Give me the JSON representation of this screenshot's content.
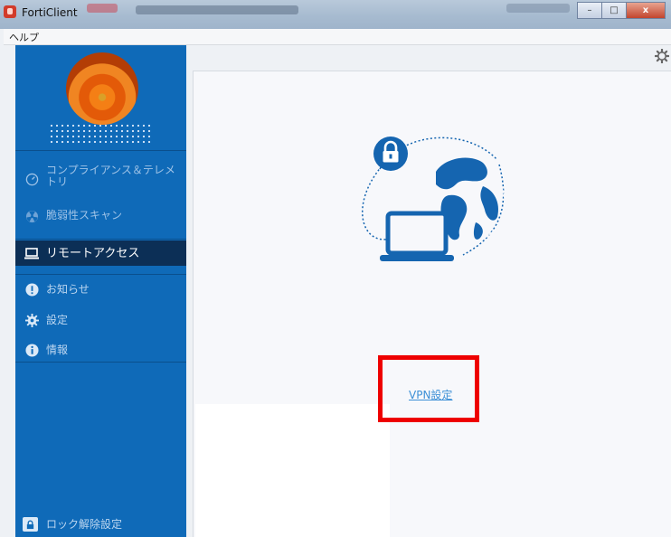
{
  "window": {
    "title": "FortiClient",
    "btn_min": "–",
    "btn_max": "□",
    "btn_close": "x"
  },
  "menu": {
    "help": "ヘルプ"
  },
  "sidebar": {
    "items": [
      {
        "label": "コンプライアンス＆テレメトリ",
        "icon": "gauge-icon"
      },
      {
        "label": "脆弱性スキャン",
        "icon": "radiation-icon"
      },
      {
        "label": "リモートアクセス",
        "icon": "laptop-icon",
        "active": true
      },
      {
        "label": "お知らせ",
        "icon": "exclamation-icon"
      },
      {
        "label": "設定",
        "icon": "gear-icon"
      },
      {
        "label": "情報",
        "icon": "info-icon"
      }
    ],
    "unlock_label": "ロック解除設定"
  },
  "main": {
    "vpn_settings_link": "VPN設定"
  },
  "colors": {
    "sidebar": "#0f6ab8",
    "active": "#0c2f56",
    "highlight": "#ee0000",
    "illustration": "#1565b0"
  }
}
